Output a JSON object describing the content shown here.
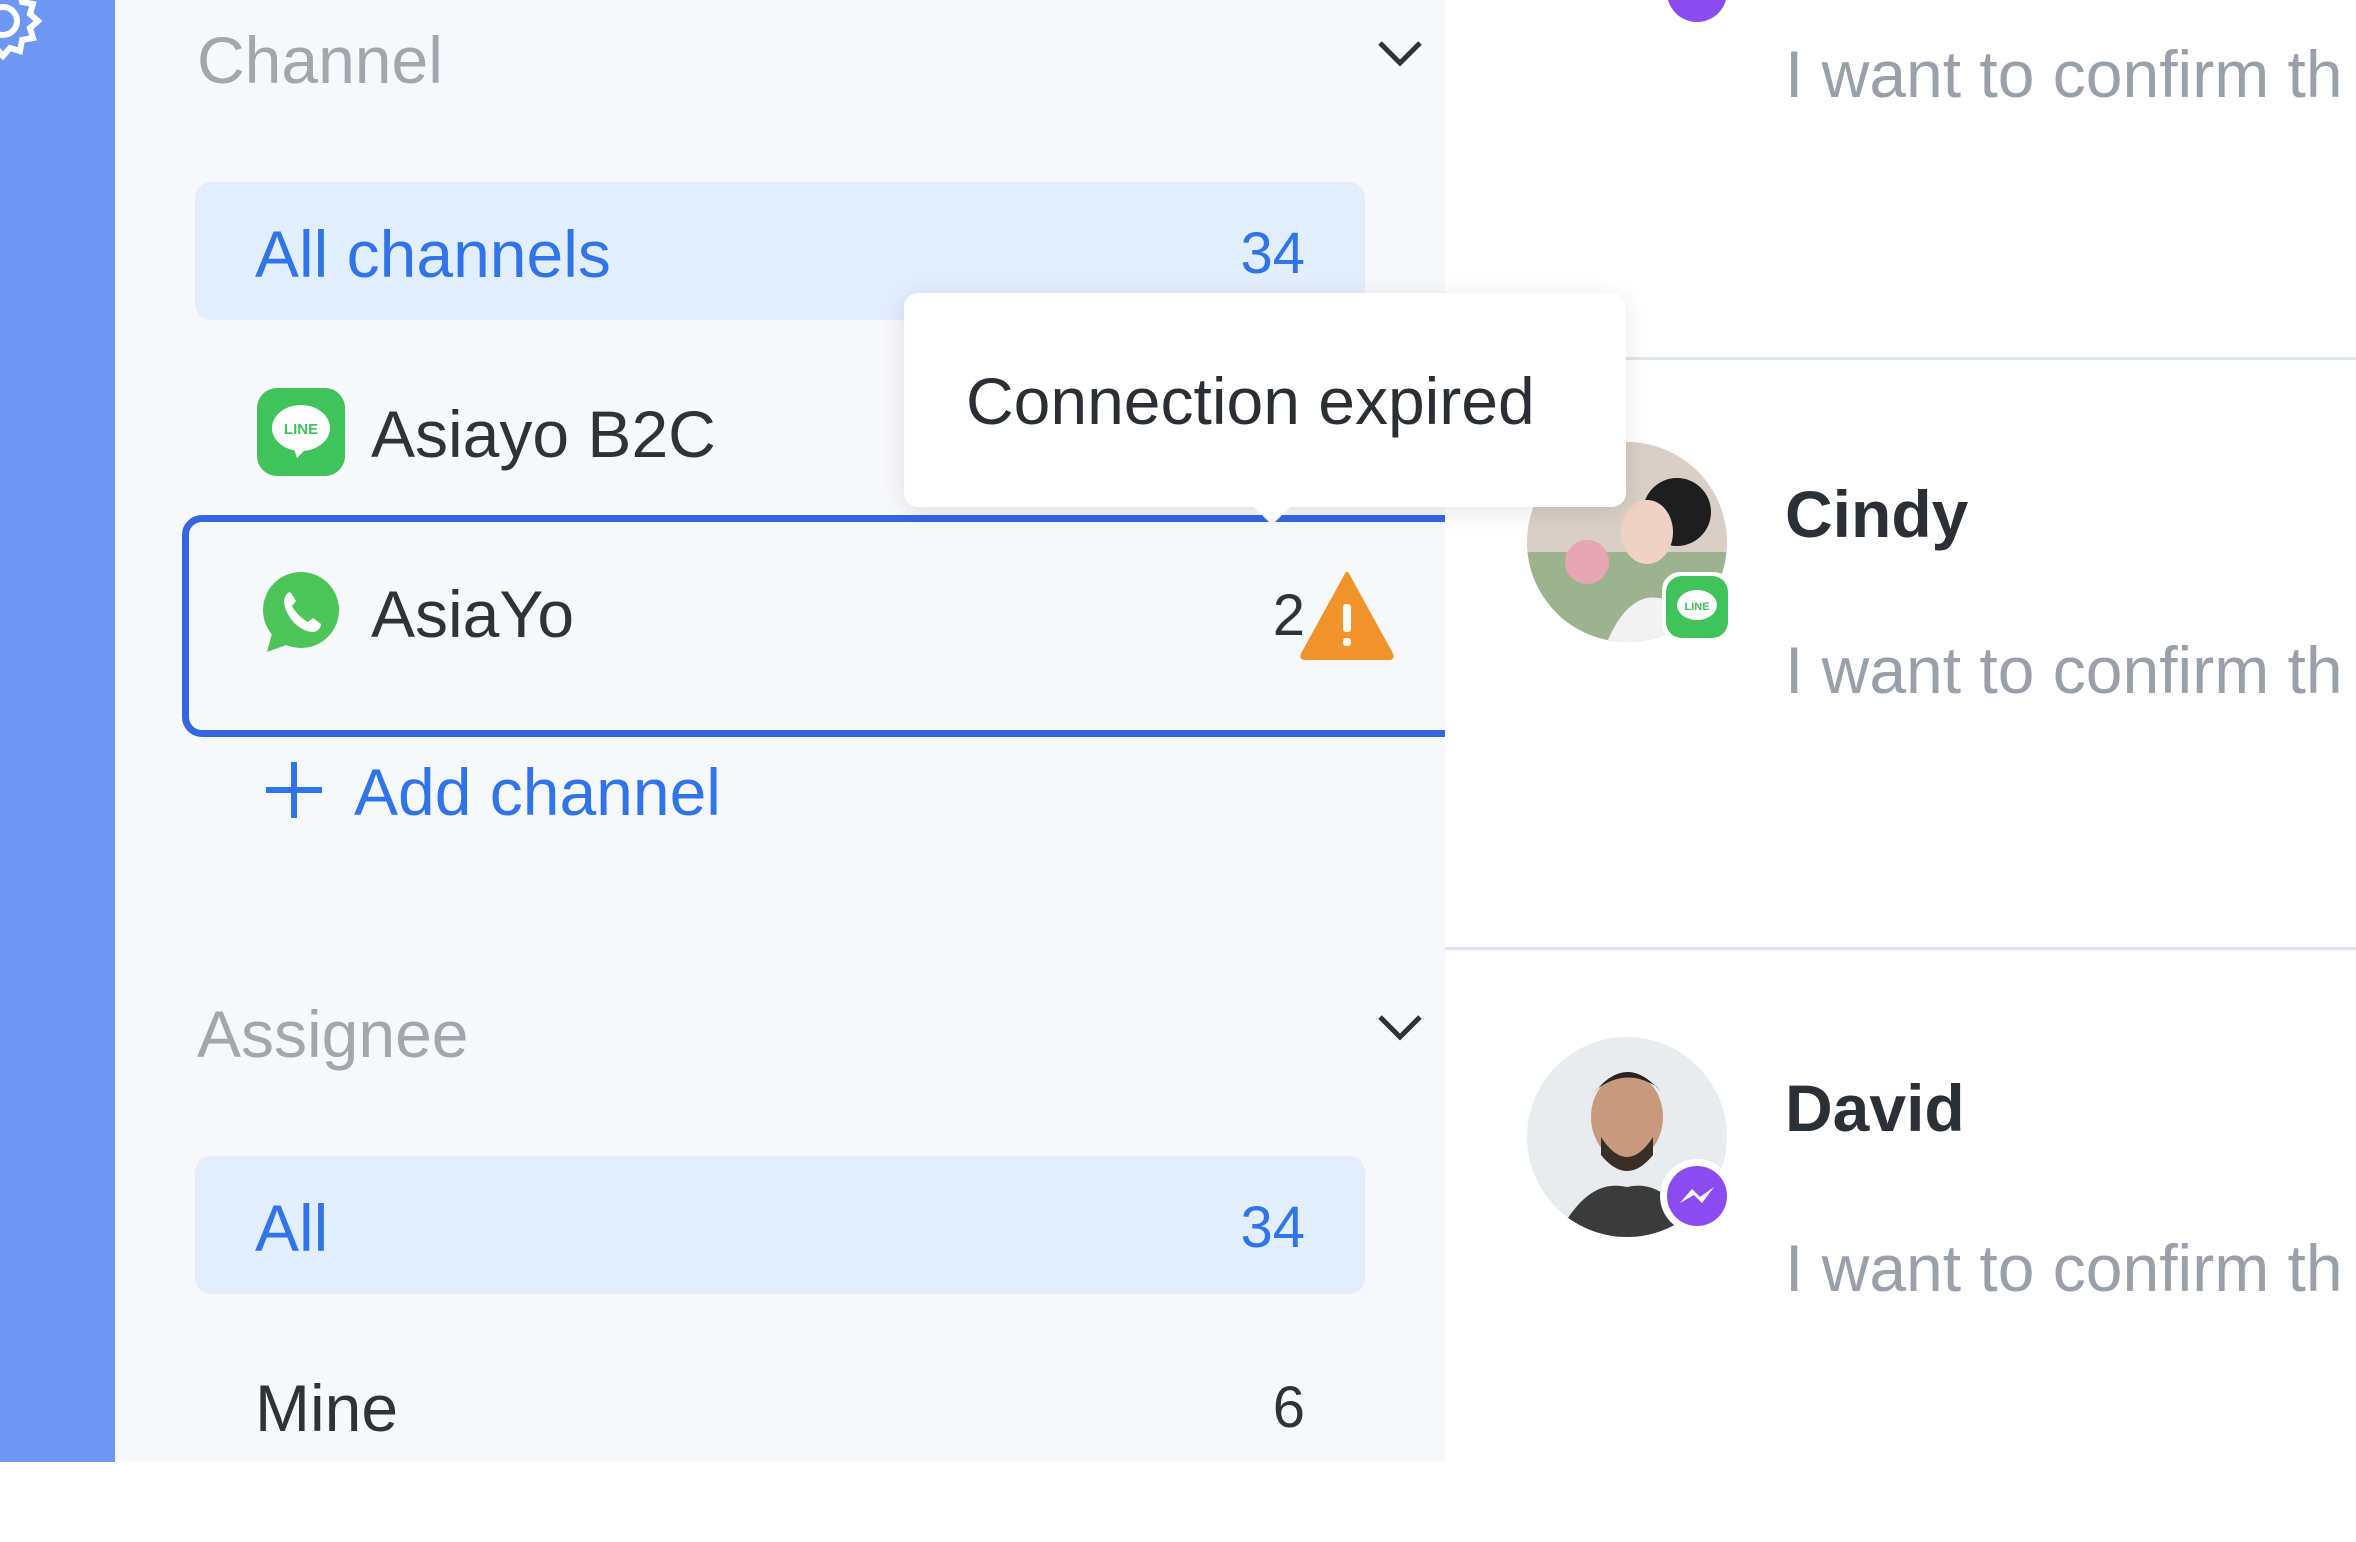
{
  "sidebar_rail": {
    "icon": "gear-icon",
    "color": "#6d96f5"
  },
  "filters": {
    "channel": {
      "title": "Channel",
      "items": [
        {
          "label": "All channels",
          "count": "34",
          "selected": true
        },
        {
          "label": "Asiayo B2C",
          "icon": "line-icon",
          "count": ""
        },
        {
          "label": "AsiaYo",
          "icon": "whatsapp-icon",
          "status_icon": "warning-icon",
          "count": "2"
        }
      ],
      "add_label": "Add channel"
    },
    "assignee": {
      "title": "Assignee",
      "items": [
        {
          "label": "All",
          "count": "34",
          "selected": true
        },
        {
          "label": "Mine",
          "count": "6"
        }
      ]
    }
  },
  "tooltip": {
    "text": "Connection expired"
  },
  "conversations": [
    {
      "name": "",
      "preview": "I want to confirm th",
      "channel_icon": "messenger-icon"
    },
    {
      "name": "Cindy",
      "preview": "I want to confirm th",
      "channel_icon": "line-icon"
    },
    {
      "name": "David",
      "preview": "I want to confirm th",
      "channel_icon": "messenger-icon"
    }
  ],
  "colors": {
    "accent": "#2f74e9",
    "selected_bg": "#e3eefd",
    "warning": "#f0932b",
    "line_green": "#3fc35a",
    "whatsapp_green": "#4cc458",
    "focus_border": "#3566e0"
  }
}
